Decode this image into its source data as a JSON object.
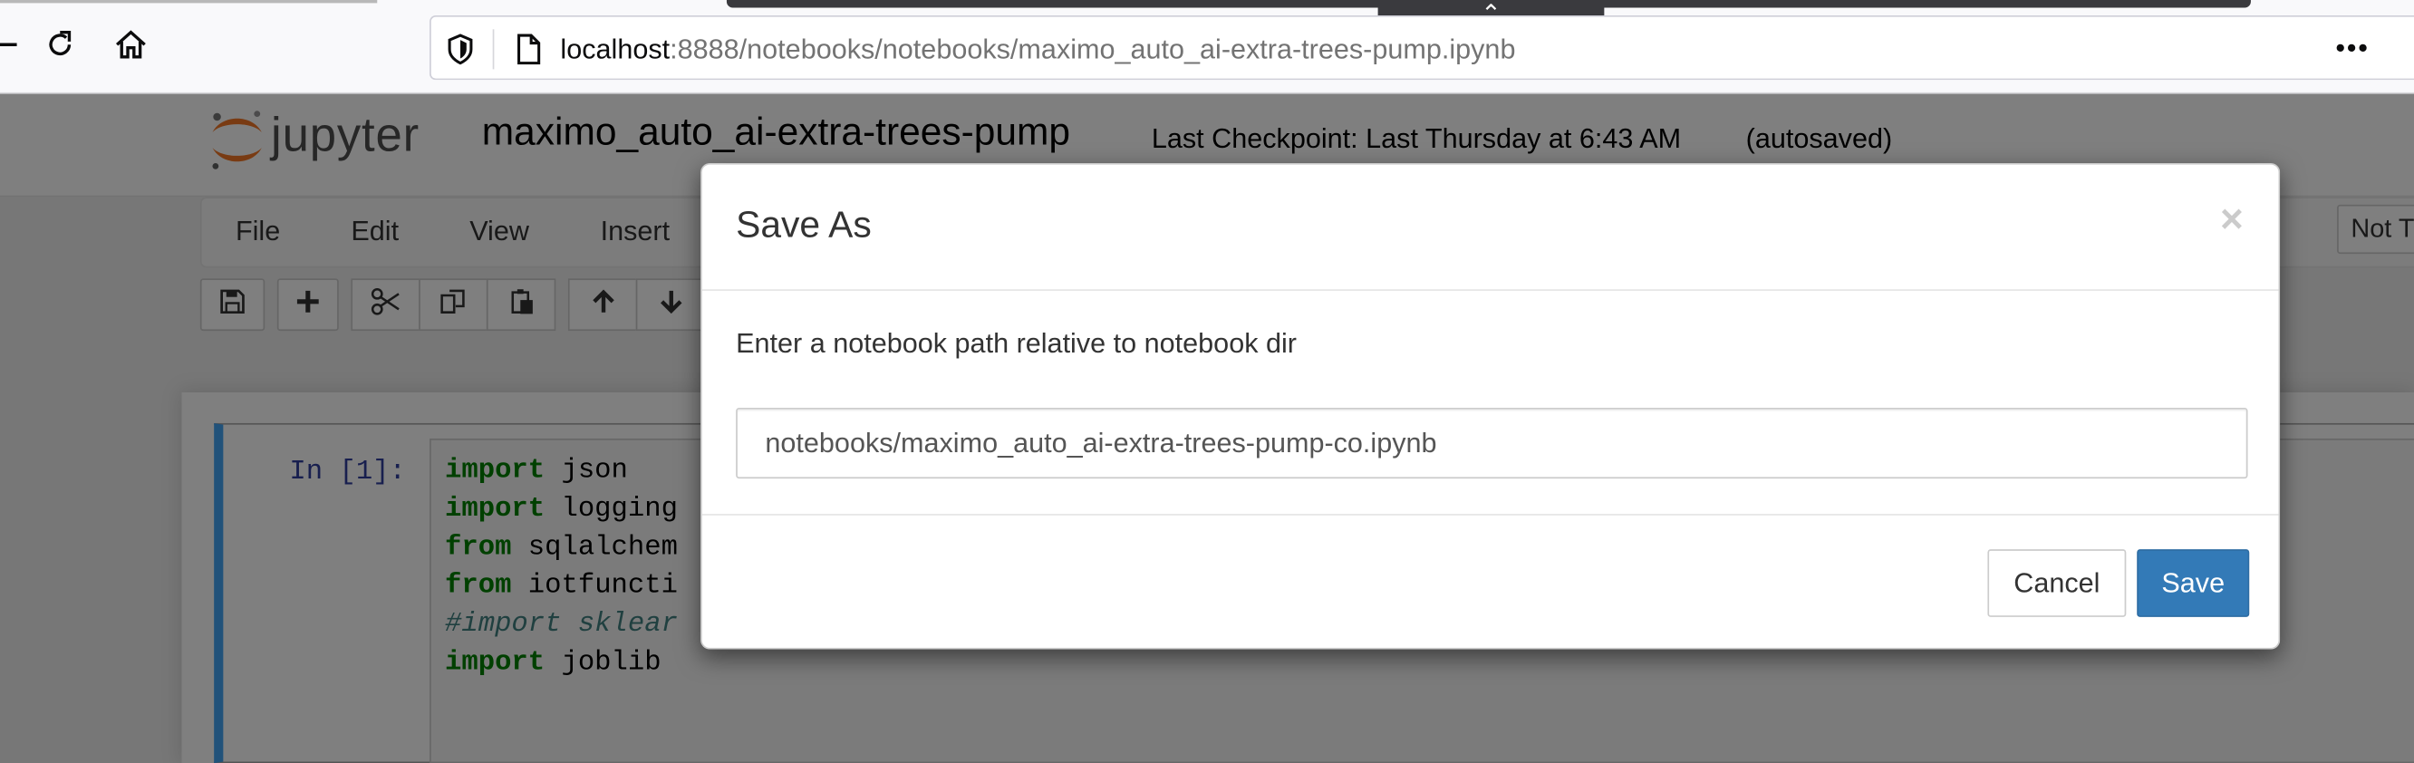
{
  "browser": {
    "url_host": "localhost",
    "url_path": ":8888/notebooks/notebooks/maximo_auto_ai-extra-trees-pump.ipynb",
    "more_label": "•••"
  },
  "jupyter": {
    "logo_text": "jupyter",
    "notebook_title": "maximo_auto_ai-extra-trees-pump",
    "checkpoint": "Last Checkpoint: Last Thursday at 6:43 AM",
    "autosave_status": "(autosaved)",
    "menu": [
      "File",
      "Edit",
      "View",
      "Insert"
    ],
    "kernel_badge": "Not Trusted"
  },
  "cell": {
    "prompt": "In [1]:",
    "lines": [
      {
        "kw": "import",
        "rest": " json"
      },
      {
        "kw": "import",
        "rest": " logging"
      },
      {
        "kw": "from",
        "rest": " sqlalchem"
      },
      {
        "kw": "from",
        "rest": " iotfuncti"
      },
      {
        "comment": "#import sklear"
      },
      {
        "kw": "import",
        "rest": " joblib"
      }
    ]
  },
  "dialog": {
    "title": "Save As",
    "close_glyph": "×",
    "prompt_text": "Enter a notebook path relative to notebook dir",
    "path_value": "notebooks/maximo_auto_ai-extra-trees-pump-co.ipynb",
    "cancel_label": "Cancel",
    "save_label": "Save"
  }
}
